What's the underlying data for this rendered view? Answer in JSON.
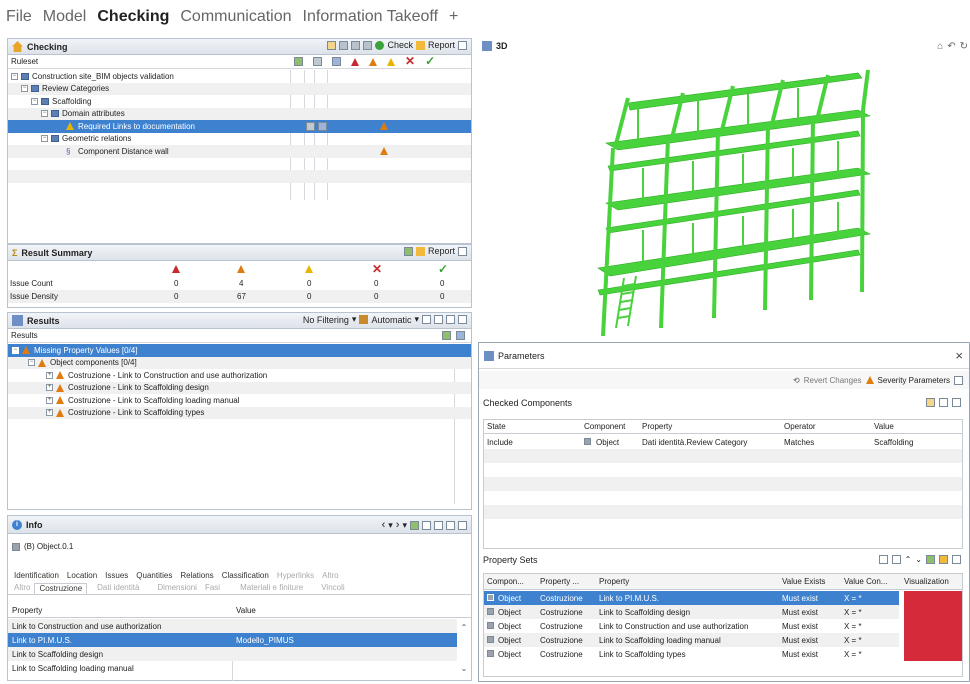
{
  "menu": [
    "File",
    "Model",
    "Checking",
    "Communication",
    "Information Takeoff",
    "+"
  ],
  "active_menu": "Checking",
  "checking": {
    "title": "Checking",
    "check_label": "Check",
    "report_label": "Report",
    "ruleset_label": "Ruleset",
    "tree": [
      {
        "label": "Construction site_BIM objects validation",
        "indent": 0
      },
      {
        "label": "Review Categories",
        "indent": 1
      },
      {
        "label": "Scaffolding",
        "indent": 2
      },
      {
        "label": "Domain attributes",
        "indent": 3
      },
      {
        "label": "Required Links to documentation",
        "indent": 4,
        "selected": true
      },
      {
        "label": "Geometric relations",
        "indent": 3
      },
      {
        "label": "Component Distance wall",
        "indent": 4
      }
    ]
  },
  "summary": {
    "title": "Result Summary",
    "report_label": "Report",
    "rows": [
      {
        "label": "Issue Count",
        "values": [
          "0",
          "4",
          "0",
          "0",
          "0"
        ]
      },
      {
        "label": "Issue Density",
        "values": [
          "0",
          "67",
          "0",
          "0",
          "0"
        ]
      }
    ]
  },
  "results": {
    "title": "Results",
    "filter_label": "No Filtering",
    "auto_label": "Automatic",
    "header_label": "Results",
    "items": [
      {
        "label": "Missing Property Values [0/4]",
        "indent": 0,
        "selected": true
      },
      {
        "label": "Object components [0/4]",
        "indent": 1
      },
      {
        "label": "Costruzione - Link to Construction and use authorization",
        "indent": 2
      },
      {
        "label": "Costruzione - Link to Scaffolding design",
        "indent": 2
      },
      {
        "label": "Costruzione - Link to Scaffolding loading manual",
        "indent": 2
      },
      {
        "label": "Costruzione - Link to Scaffolding types",
        "indent": 2
      }
    ]
  },
  "info": {
    "title": "Info",
    "object_label": "(B) Object.0.1",
    "tabs1": [
      "Identification",
      "Location",
      "Issues",
      "Quantities",
      "Relations",
      "Classification",
      "Hyperlinks",
      "Altro"
    ],
    "tabs2": [
      "Altro",
      "Costruzione",
      "Dati identità",
      "Dimensioni",
      "Fasi",
      "Materiali e finiture",
      "Vincoli"
    ],
    "col_property": "Property",
    "col_value": "Value",
    "rows": [
      {
        "property": "Link to Construction and use authorization",
        "value": ""
      },
      {
        "property": "Link to PI.M.U.S.",
        "value": "Modello_PIMUS",
        "selected": true
      },
      {
        "property": "Link to Scaffolding design",
        "value": ""
      },
      {
        "property": "Link to Scaffolding loading manual",
        "value": ""
      }
    ]
  },
  "view3d": {
    "title": "3D"
  },
  "parameters": {
    "title": "Parameters",
    "revert_label": "Revert Changes",
    "severity_label": "Severity Parameters",
    "checked_title": "Checked Components",
    "checked_cols": [
      "State",
      "Component",
      "Property",
      "Operator",
      "Value"
    ],
    "checked_rows": [
      {
        "state": "Include",
        "component": "Object",
        "property": "Dati identità.Review Category",
        "operator": "Matches",
        "value": "Scaffolding"
      }
    ],
    "psets_title": "Property Sets",
    "psets_cols": [
      "Compon...",
      "Property ...",
      "Property",
      "Value Exists",
      "Value Con...",
      "Visualization"
    ],
    "psets_rows": [
      {
        "component": "Object",
        "pset": "Costruzione",
        "property": "Link to PI.M.U.S.",
        "exists": "Must exist",
        "cond": "X = *",
        "selected": true
      },
      {
        "component": "Object",
        "pset": "Costruzione",
        "property": "Link to Scaffolding design",
        "exists": "Must exist",
        "cond": "X = *"
      },
      {
        "component": "Object",
        "pset": "Costruzione",
        "property": "Link to Construction and use authorization",
        "exists": "Must exist",
        "cond": "X = *"
      },
      {
        "component": "Object",
        "pset": "Costruzione",
        "property": "Link to Scaffolding loading manual",
        "exists": "Must exist",
        "cond": "X = *"
      },
      {
        "component": "Object",
        "pset": "Costruzione",
        "property": "Link to Scaffolding types",
        "exists": "Must exist",
        "cond": "X = *"
      }
    ]
  },
  "colors": {
    "selection": "#3e82cf",
    "scaffold": "#48d23c",
    "issue_red": "#d42a3a",
    "accent": "#e07b12"
  }
}
